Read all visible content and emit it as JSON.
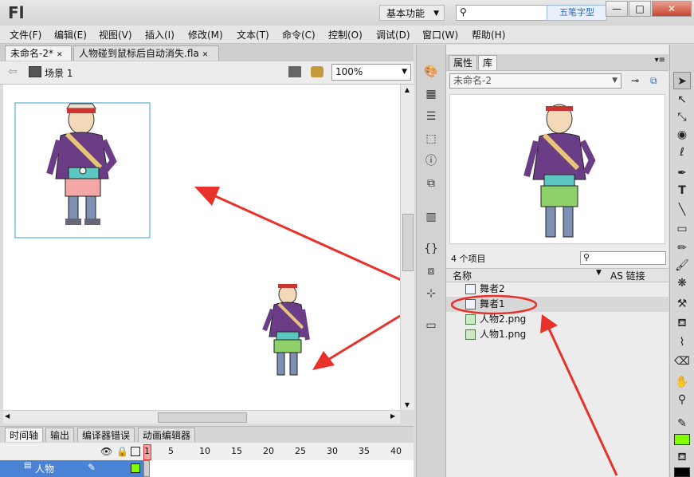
{
  "window": {
    "app_logo": "Fl",
    "workspace": "基本功能",
    "watermark": "五笔字型",
    "buttons": [
      "—",
      "□",
      "✕"
    ]
  },
  "menu": [
    "文件(F)",
    "编辑(E)",
    "视图(V)",
    "插入(I)",
    "修改(M)",
    "文本(T)",
    "命令(C)",
    "控制(O)",
    "调试(D)",
    "窗口(W)",
    "帮助(H)"
  ],
  "doc_tabs": [
    {
      "label": "未命名-2*",
      "close": "✕"
    },
    {
      "label": "人物碰到鼠标后自动消失.fla",
      "close": "✕"
    }
  ],
  "editbar": {
    "back_arrow": "⇦",
    "scene": "场景 1",
    "zoom": "100%"
  },
  "timeline": {
    "tabs": [
      "时间轴",
      "输出",
      "编译器错误",
      "动画编辑器"
    ],
    "frame_numbers": [
      "1",
      "5",
      "10",
      "15",
      "20",
      "25",
      "30",
      "35",
      "40"
    ],
    "layer_name": "人物"
  },
  "panel": {
    "tabs": [
      "属性",
      "库"
    ],
    "library_doc": "未命名-2",
    "item_count": "4 个项目",
    "col_name": "名称",
    "col_link": "AS 链接",
    "items": [
      {
        "name": "舞者2",
        "type": "symbol"
      },
      {
        "name": "舞者1",
        "type": "symbol"
      },
      {
        "name": "人物2.png",
        "type": "bitmap"
      },
      {
        "name": "人物1.png",
        "type": "bitmap"
      }
    ]
  },
  "colors": {
    "stroke": "#000000",
    "fill": "#7fff00",
    "annotation": "#e8312a"
  }
}
